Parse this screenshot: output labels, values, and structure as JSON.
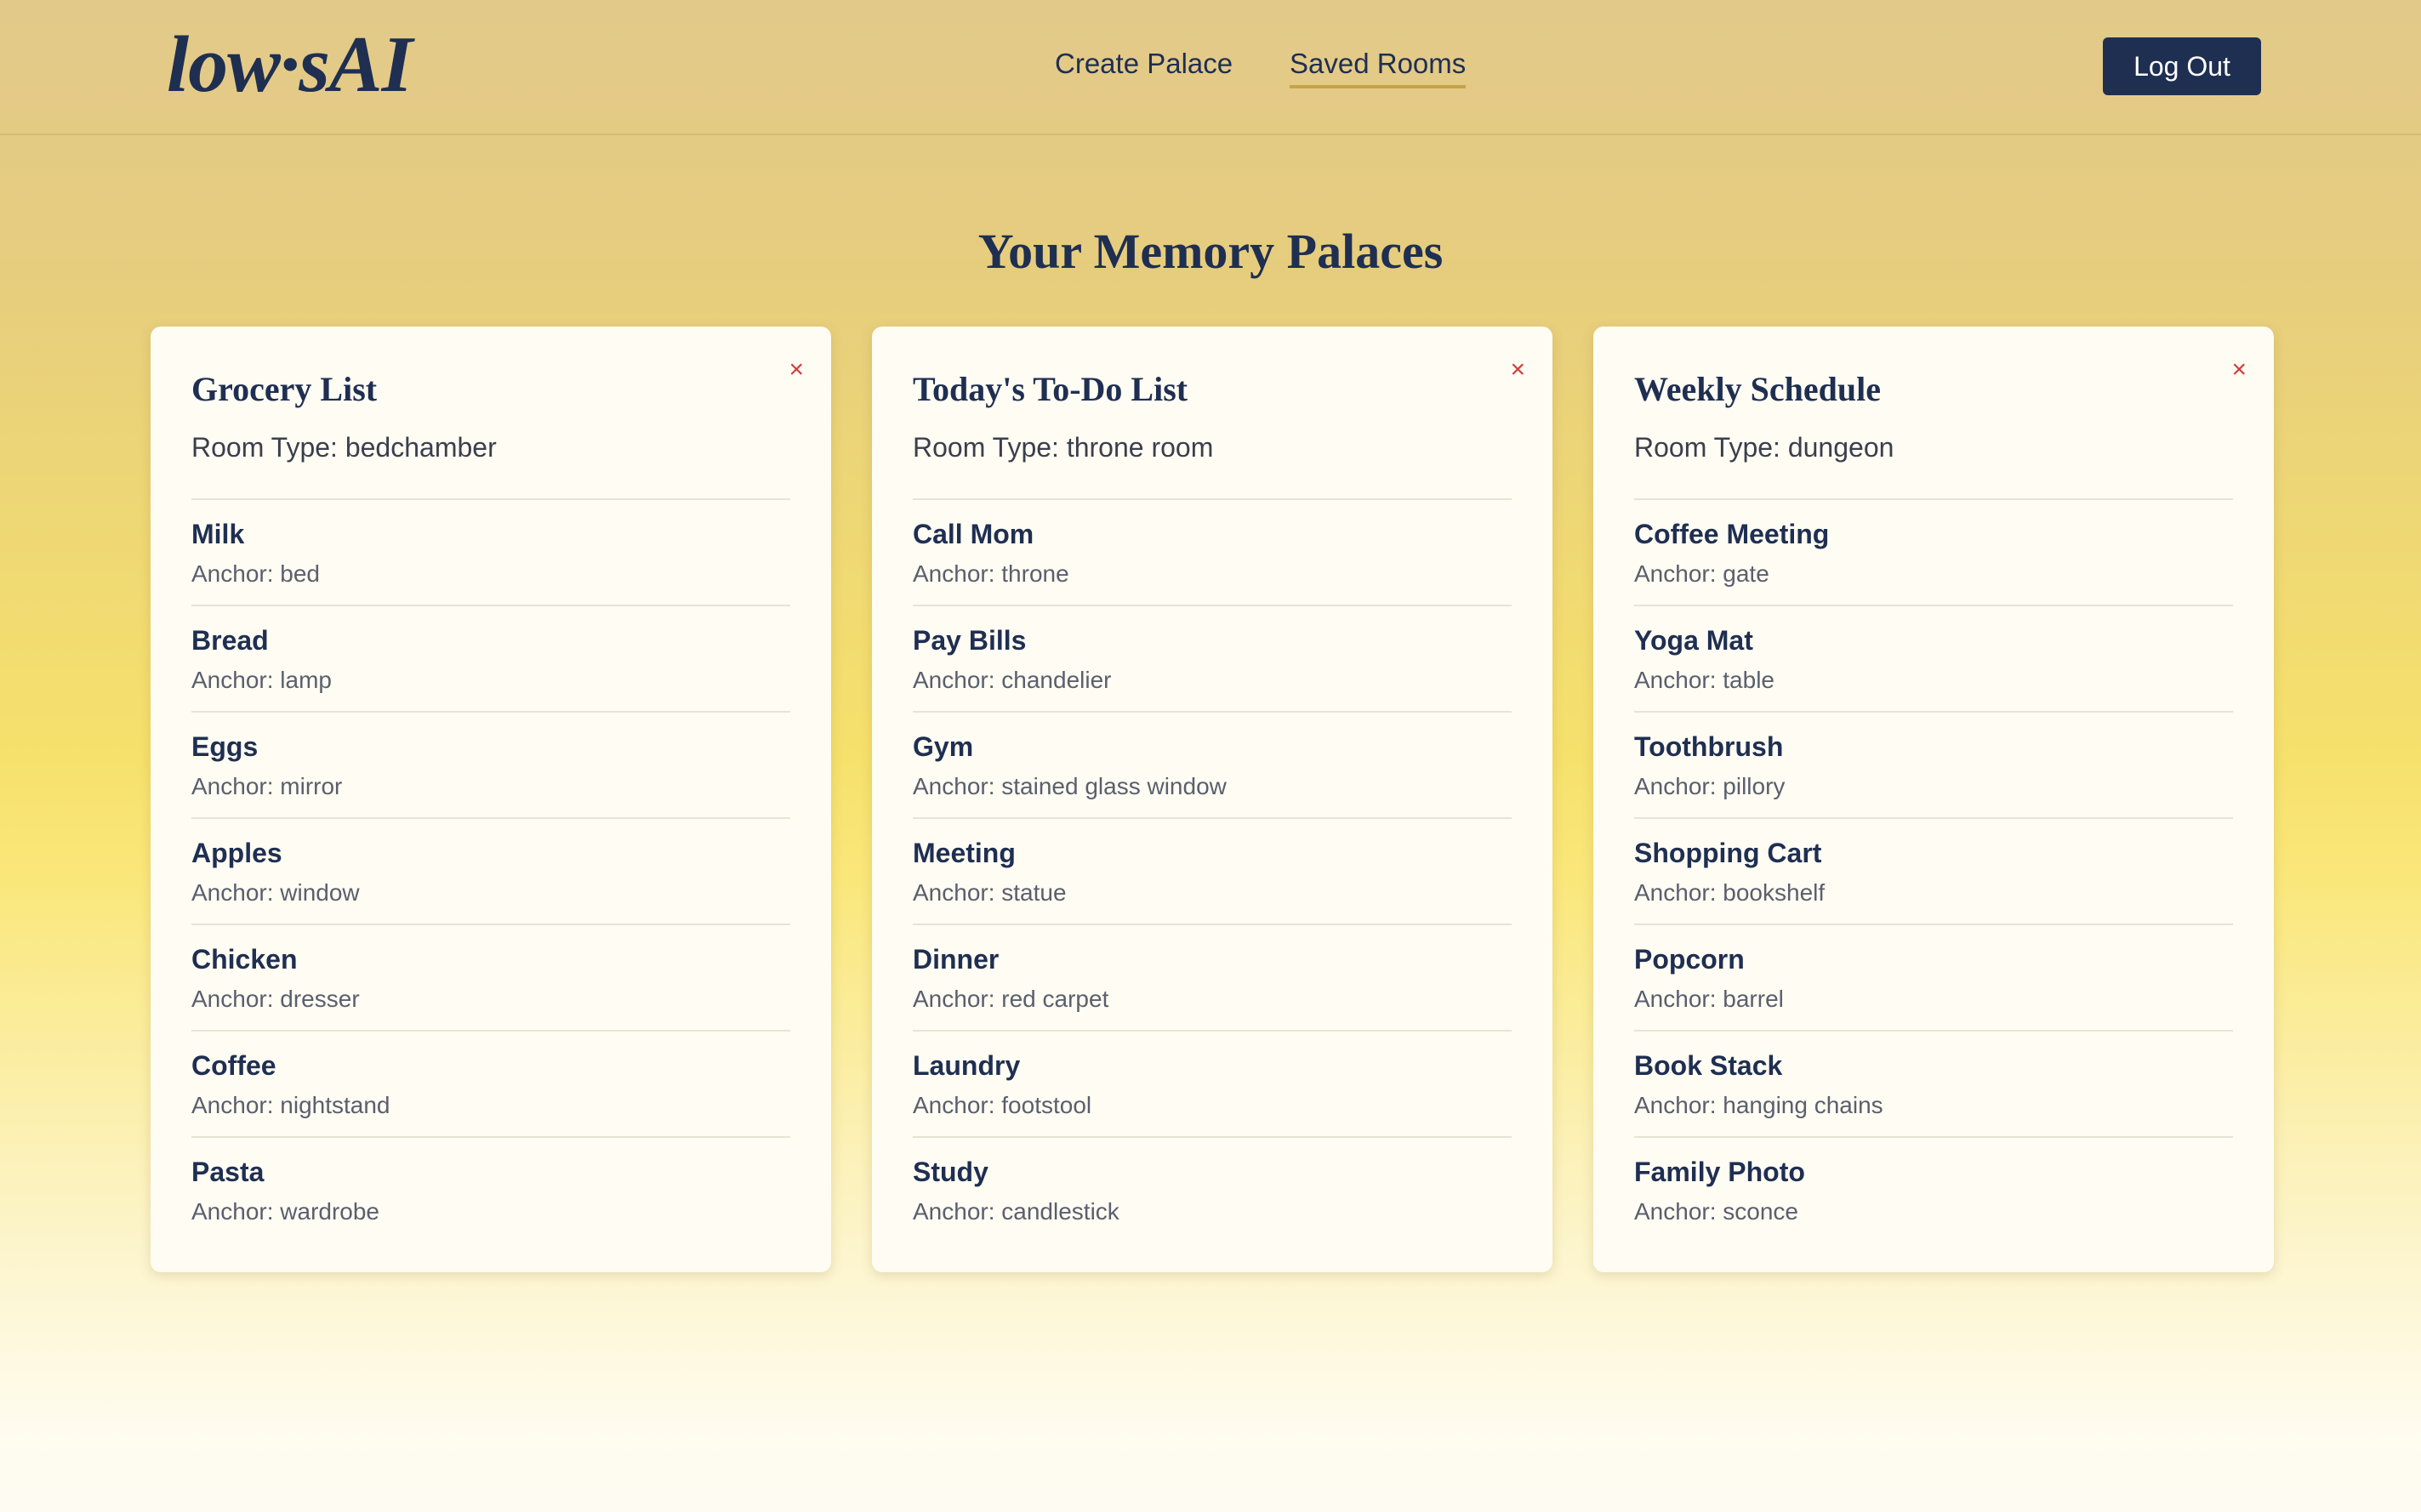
{
  "app": {
    "logo": "low·sAI"
  },
  "nav": {
    "create_label": "Create Palace",
    "saved_label": "Saved Rooms",
    "logout_label": "Log Out"
  },
  "page": {
    "title": "Your Memory Palaces"
  },
  "colors": {
    "accent": "#1f2f52",
    "underline": "#c9a24a",
    "delete": "#d33a3a"
  },
  "cards": [
    {
      "title": "Grocery List",
      "room_type": "Room Type: bedchamber",
      "close": "×",
      "items": [
        {
          "name": "Milk",
          "anchor": "Anchor: bed"
        },
        {
          "name": "Bread",
          "anchor": "Anchor: lamp"
        },
        {
          "name": "Eggs",
          "anchor": "Anchor: mirror"
        },
        {
          "name": "Apples",
          "anchor": "Anchor: window"
        },
        {
          "name": "Chicken",
          "anchor": "Anchor: dresser"
        },
        {
          "name": "Coffee",
          "anchor": "Anchor: nightstand"
        },
        {
          "name": "Pasta",
          "anchor": "Anchor: wardrobe"
        }
      ]
    },
    {
      "title": "Today's To-Do List",
      "room_type": "Room Type: throne room",
      "close": "×",
      "items": [
        {
          "name": "Call Mom",
          "anchor": "Anchor: throne"
        },
        {
          "name": "Pay Bills",
          "anchor": "Anchor: chandelier"
        },
        {
          "name": "Gym",
          "anchor": "Anchor: stained glass window"
        },
        {
          "name": "Meeting",
          "anchor": "Anchor: statue"
        },
        {
          "name": "Dinner",
          "anchor": "Anchor: red carpet"
        },
        {
          "name": "Laundry",
          "anchor": "Anchor: footstool"
        },
        {
          "name": "Study",
          "anchor": "Anchor: candlestick"
        }
      ]
    },
    {
      "title": "Weekly Schedule",
      "room_type": "Room Type: dungeon",
      "close": "×",
      "items": [
        {
          "name": "Coffee Meeting",
          "anchor": "Anchor: gate"
        },
        {
          "name": "Yoga Mat",
          "anchor": "Anchor: table"
        },
        {
          "name": "Toothbrush",
          "anchor": "Anchor: pillory"
        },
        {
          "name": "Shopping Cart",
          "anchor": "Anchor: bookshelf"
        },
        {
          "name": "Popcorn",
          "anchor": "Anchor: barrel"
        },
        {
          "name": "Book Stack",
          "anchor": "Anchor: hanging chains"
        },
        {
          "name": "Family Photo",
          "anchor": "Anchor: sconce"
        }
      ]
    }
  ]
}
